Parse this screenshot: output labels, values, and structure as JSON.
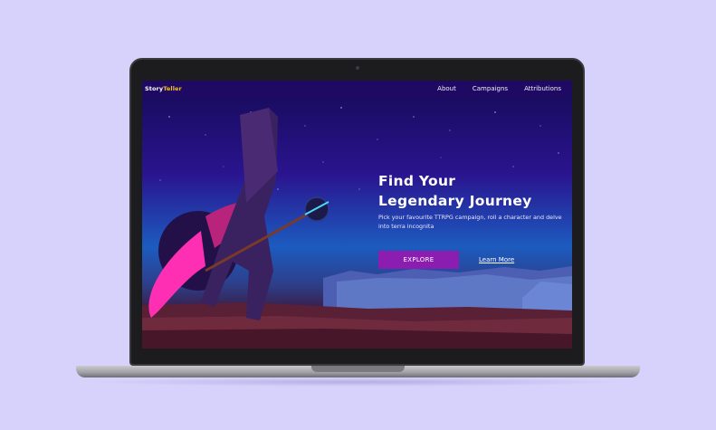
{
  "site": {
    "logo_prefix": "Story",
    "logo_accent": "Teller"
  },
  "nav": {
    "items": [
      {
        "label": "About"
      },
      {
        "label": "Campaigns"
      },
      {
        "label": "Attributions"
      }
    ]
  },
  "hero": {
    "title_line1": "Find Your",
    "title_line2": "Legendary Journey",
    "subtitle": "Pick your favourite TTRPG campaign, roll a character and delve into terra incognita",
    "explore_label": "EXPLORE",
    "learn_more_label": "Learn More"
  },
  "colors": {
    "page_background": "#d6d2fb",
    "navbar": "#1f0a63",
    "logo_accent": "#f4c21b",
    "explore_button": "#8b1db1",
    "cape": "#ff2fb3"
  }
}
